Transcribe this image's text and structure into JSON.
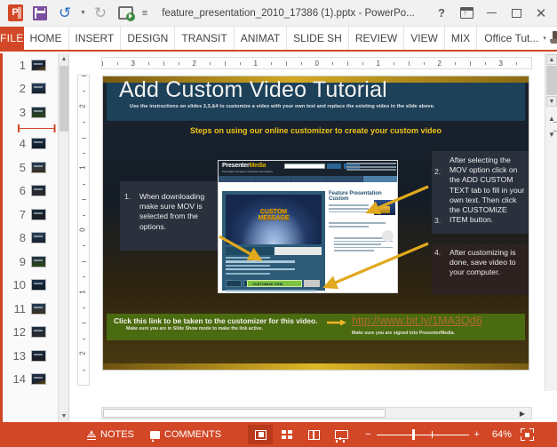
{
  "titlebar": {
    "document_title": "feature_presentation_2010_17386 (1).pptx - PowerPo...",
    "qat": [
      {
        "name": "powerpoint-logo",
        "label": "P"
      },
      {
        "name": "save-icon",
        "label": "Save"
      },
      {
        "name": "undo-icon",
        "label": "Undo"
      },
      {
        "name": "redo-icon",
        "label": "Redo"
      },
      {
        "name": "start-slideshow-icon",
        "label": "Start From Beginning"
      },
      {
        "name": "customize-qat-icon",
        "label": "Customize Quick Access Toolbar"
      }
    ],
    "window_controls": [
      {
        "name": "help-button",
        "label": "?"
      },
      {
        "name": "ribbon-display-options-button",
        "label": "Ribbon Display Options"
      },
      {
        "name": "minimize-button",
        "label": "Minimize"
      },
      {
        "name": "maximize-button",
        "label": "Maximize"
      },
      {
        "name": "close-button",
        "label": "✕"
      }
    ]
  },
  "ribbon": {
    "file_tab": "FILE",
    "tabs": [
      "HOME",
      "INSERT",
      "DESIGN",
      "TRANSIT",
      "ANIMAT",
      "SLIDE SH",
      "REVIEW",
      "VIEW",
      "MIX"
    ],
    "account": "Office Tut...",
    "account_caret": "▾"
  },
  "thumbnail_pane": {
    "slides": [
      {
        "number": "1",
        "thumb": "t1"
      },
      {
        "number": "2",
        "thumb": "t2"
      },
      {
        "number": "3",
        "thumb": "t3"
      },
      {
        "number": "4",
        "thumb": "t4"
      },
      {
        "number": "5",
        "thumb": "t5"
      },
      {
        "number": "6",
        "thumb": "t6"
      },
      {
        "number": "7",
        "thumb": "t7"
      },
      {
        "number": "8",
        "thumb": "t2"
      },
      {
        "number": "9",
        "thumb": "t3"
      },
      {
        "number": "10",
        "thumb": "t4"
      },
      {
        "number": "11",
        "thumb": "t5"
      },
      {
        "number": "12",
        "thumb": "t6"
      },
      {
        "number": "13",
        "thumb": "t7"
      },
      {
        "number": "14",
        "thumb": "t1"
      }
    ],
    "insertion_after_slide": "3"
  },
  "rulers": {
    "horizontal_ticks": [
      "3",
      "2",
      "1",
      "0",
      "1",
      "2",
      "3"
    ],
    "vertical_ticks": [
      "2",
      "1",
      "0",
      "1",
      "2"
    ]
  },
  "slide": {
    "title": "Add Custom Video Tutorial",
    "subtitle": "Use the instructions on slides 2,3,&4 to customize a video with your own text and replace the existing video in the slide above.",
    "steps_heading": "Steps on using our online customizer to create your custom video",
    "callouts": [
      {
        "num": "1.",
        "text": "When downloading make sure MOV is selected from the options."
      },
      {
        "num": "2.",
        "num_b": "3.",
        "text": "After selecting the MOV option click on the ADD CUSTOM TEXT tab to fill in your own text.  Then click the CUSTOMIZE ITEM button."
      },
      {
        "num": "4.",
        "text": "After customizing is done, save video to your computer."
      }
    ],
    "screenshot": {
      "site_name": "Presenter",
      "site_name_accent": "Media",
      "site_tagline": "Presentation Templates, Animations and Graphics",
      "video_caption_line1": "CUSTOM",
      "video_caption_line2": "MESSAGE",
      "panel_title": "Feature Presentation Custom",
      "customize_button": "CUSTOMIZE ITEM"
    },
    "link_bar": {
      "main_text": "Click this link to be taken to the customizer for this video.",
      "sub_text": "Make sure you are in Slide Show mode to make the link active.",
      "url": "http://www.bit.ly/1MA3Qd6",
      "note": "Make sure you are signed into PresenterMedia."
    }
  },
  "statusbar": {
    "notes_label": "NOTES",
    "comments_label": "COMMENTS",
    "views": [
      {
        "name": "normal-view-button",
        "label": "Normal",
        "active": true
      },
      {
        "name": "slide-sorter-view-button",
        "label": "Slide Sorter",
        "active": false
      },
      {
        "name": "reading-view-button",
        "label": "Reading View",
        "active": false
      },
      {
        "name": "slideshow-view-button",
        "label": "Slide Show",
        "active": false
      }
    ],
    "zoom_out": "−",
    "zoom_in": "+",
    "zoom_level": "64%",
    "fit_label": "Fit slide to current window"
  }
}
